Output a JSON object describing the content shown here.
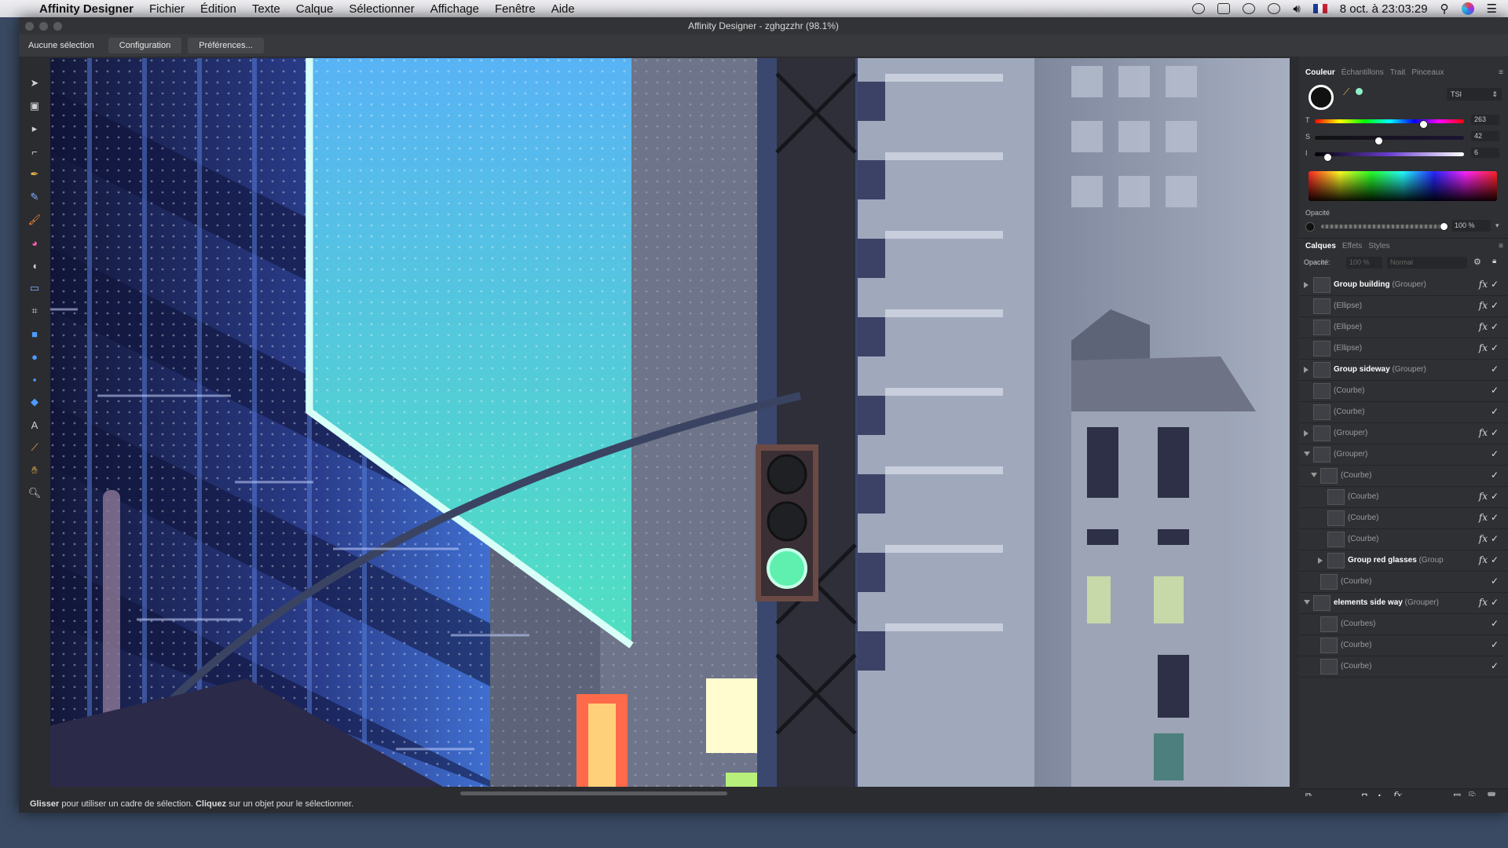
{
  "menubar": {
    "app_name": "Affinity Designer",
    "items": [
      "Fichier",
      "Édition",
      "Texte",
      "Calque",
      "Sélectionner",
      "Affichage",
      "Fenêtre",
      "Aide"
    ],
    "datetime": "8 oct. à 23:03:29"
  },
  "window": {
    "title": "Affinity Designer - zghgzzhr (98.1%)"
  },
  "context_bar": {
    "selection_label": "Aucune sélection",
    "config_label": "Configuration",
    "prefs_label": "Préférences..."
  },
  "color_panel": {
    "tabs": [
      "Couleur",
      "Échantillons",
      "Trait",
      "Pinceaux"
    ],
    "mode": "TSI",
    "sliders": [
      {
        "label": "T",
        "value": "263",
        "fraction": 0.73
      },
      {
        "label": "S",
        "value": "42",
        "fraction": 0.42
      },
      {
        "label": "I",
        "value": "6",
        "fraction": 0.06
      }
    ],
    "opacity_label": "Opacité",
    "opacity_value": "100 %"
  },
  "layers_panel": {
    "tabs": [
      "Calques",
      "Effets",
      "Styles"
    ],
    "opacity_label": "Opacité:",
    "opacity_value": "100 %",
    "blend_mode": "Normal",
    "rows": [
      {
        "name": "Group building",
        "type": "(Grouper)",
        "bold": true,
        "indent": 0,
        "expander": "closed",
        "fx": true
      },
      {
        "name": "",
        "type": "(Ellipse)",
        "bold": false,
        "indent": 0,
        "expander": "none",
        "fx": true
      },
      {
        "name": "",
        "type": "(Ellipse)",
        "bold": false,
        "indent": 0,
        "expander": "none",
        "fx": true
      },
      {
        "name": "",
        "type": "(Ellipse)",
        "bold": false,
        "indent": 0,
        "expander": "none",
        "fx": true
      },
      {
        "name": "Group sideway",
        "type": "(Grouper)",
        "bold": true,
        "indent": 0,
        "expander": "closed",
        "fx": false
      },
      {
        "name": "",
        "type": "(Courbe)",
        "bold": false,
        "indent": 0,
        "expander": "none",
        "fx": false
      },
      {
        "name": "",
        "type": "(Courbe)",
        "bold": false,
        "indent": 0,
        "expander": "none",
        "fx": false
      },
      {
        "name": "",
        "type": "(Grouper)",
        "bold": false,
        "indent": 0,
        "expander": "closed",
        "fx": true
      },
      {
        "name": "",
        "type": "(Grouper)",
        "bold": false,
        "indent": 0,
        "expander": "open",
        "fx": false
      },
      {
        "name": "",
        "type": "(Courbe)",
        "bold": false,
        "indent": 1,
        "expander": "open",
        "fx": false
      },
      {
        "name": "",
        "type": "(Courbe)",
        "bold": false,
        "indent": 2,
        "expander": "none",
        "fx": true
      },
      {
        "name": "",
        "type": "(Courbe)",
        "bold": false,
        "indent": 2,
        "expander": "none",
        "fx": true
      },
      {
        "name": "",
        "type": "(Courbe)",
        "bold": false,
        "indent": 2,
        "expander": "none",
        "fx": true
      },
      {
        "name": "Group red glasses",
        "type": "(Group",
        "bold": true,
        "indent": 2,
        "expander": "closed",
        "fx": true
      },
      {
        "name": "",
        "type": "(Courbe)",
        "bold": false,
        "indent": 1,
        "expander": "none",
        "fx": false
      },
      {
        "name": "elements side way",
        "type": "(Grouper)",
        "bold": true,
        "indent": 0,
        "expander": "open",
        "fx": true
      },
      {
        "name": "",
        "type": "(Courbes)",
        "bold": false,
        "indent": 1,
        "expander": "none",
        "fx": false
      },
      {
        "name": "",
        "type": "(Courbe)",
        "bold": false,
        "indent": 1,
        "expander": "none",
        "fx": false
      },
      {
        "name": "",
        "type": "(Courbe)",
        "bold": false,
        "indent": 1,
        "expander": "none",
        "fx": false
      }
    ]
  },
  "status_bar": {
    "word1": "Glisser",
    "text1": " pour utiliser un cadre de sélection. ",
    "word2": "Cliquez",
    "text2": " sur un objet pour le sélectionner."
  },
  "tools": [
    "move-tool-icon",
    "artboard-tool-icon",
    "node-tool-icon",
    "corner-tool-icon",
    "pen-tool-icon",
    "pencil-tool-icon",
    "vector-brush-icon",
    "fill-tool-icon",
    "transparency-tool-icon",
    "place-image-icon",
    "crop-tool-icon",
    "rectangle-tool-icon",
    "ellipse-tool-icon",
    "rounded-rect-tool-icon",
    "shape-tool-icon",
    "text-tool-icon",
    "color-picker-icon",
    "hand-tool-icon",
    "zoom-tool-icon"
  ]
}
